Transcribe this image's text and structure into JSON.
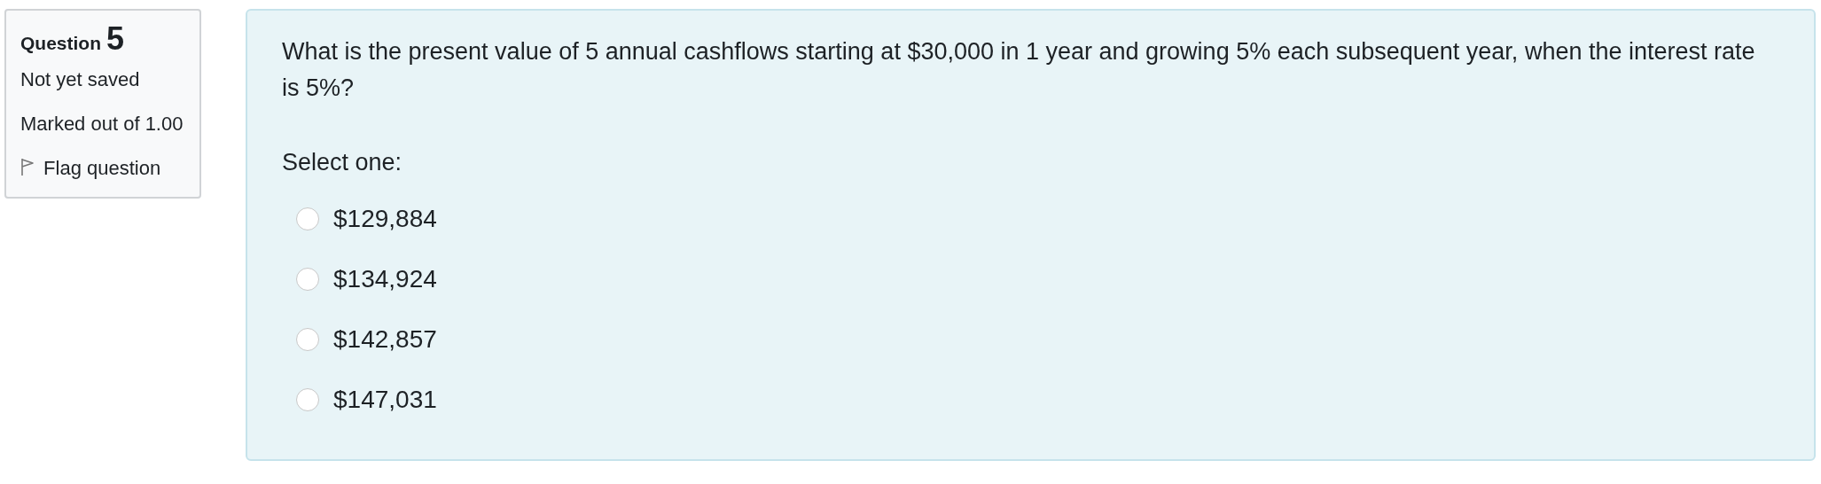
{
  "info": {
    "question_label": "Question",
    "question_number": "5",
    "status": "Not yet saved",
    "mark": "Marked out of 1.00",
    "flag_link": "Flag question"
  },
  "question": {
    "text": "What is the present value of 5 annual cashflows starting at $30,000 in 1 year and growing 5% each subsequent year, when the interest rate is 5%?",
    "prompt": "Select one:",
    "options": [
      {
        "label": "$129,884",
        "selected": false
      },
      {
        "label": "$134,924",
        "selected": false
      },
      {
        "label": "$142,857",
        "selected": false
      },
      {
        "label": "$147,031",
        "selected": false
      }
    ]
  }
}
